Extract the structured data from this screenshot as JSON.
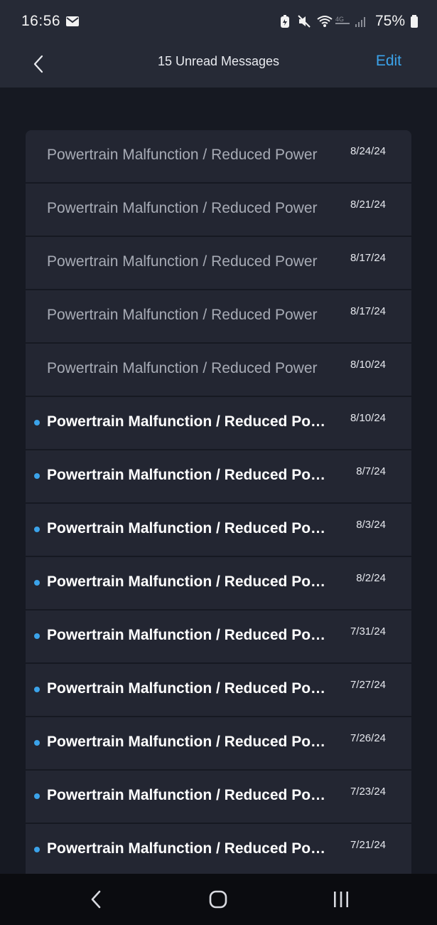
{
  "status_bar": {
    "time": "16:56",
    "battery_percent": "75%",
    "icons": [
      "mail-icon",
      "battery-saver-icon",
      "mute-icon",
      "wifi-icon",
      "volte-icon",
      "signal-icon",
      "battery-icon"
    ]
  },
  "header": {
    "title": "15 Unread Messages",
    "edit_label": "Edit"
  },
  "messages": [
    {
      "title": "Powertrain Malfunction / Reduced Power",
      "date": "8/24/24",
      "unread": false
    },
    {
      "title": "Powertrain Malfunction / Reduced Power",
      "date": "8/21/24",
      "unread": false
    },
    {
      "title": "Powertrain Malfunction / Reduced Power",
      "date": "8/17/24",
      "unread": false
    },
    {
      "title": "Powertrain Malfunction / Reduced Power",
      "date": "8/17/24",
      "unread": false
    },
    {
      "title": "Powertrain Malfunction / Reduced Power",
      "date": "8/10/24",
      "unread": false
    },
    {
      "title": "Powertrain Malfunction / Reduced Power",
      "date": "8/10/24",
      "unread": true
    },
    {
      "title": "Powertrain Malfunction / Reduced Power",
      "date": "8/7/24",
      "unread": true
    },
    {
      "title": "Powertrain Malfunction / Reduced Power",
      "date": "8/3/24",
      "unread": true
    },
    {
      "title": "Powertrain Malfunction / Reduced Power",
      "date": "8/2/24",
      "unread": true
    },
    {
      "title": "Powertrain Malfunction / Reduced Power",
      "date": "7/31/24",
      "unread": true
    },
    {
      "title": "Powertrain Malfunction / Reduced Power",
      "date": "7/27/24",
      "unread": true
    },
    {
      "title": "Powertrain Malfunction / Reduced Power",
      "date": "7/26/24",
      "unread": true
    },
    {
      "title": "Powertrain Malfunction / Reduced Power",
      "date": "7/23/24",
      "unread": true
    },
    {
      "title": "Powertrain Malfunction / Reduced Power",
      "date": "7/21/24",
      "unread": true
    }
  ],
  "colors": {
    "accent": "#3ba3ea",
    "background": "#161922",
    "row_background": "#232632",
    "header_background": "#262a36"
  }
}
